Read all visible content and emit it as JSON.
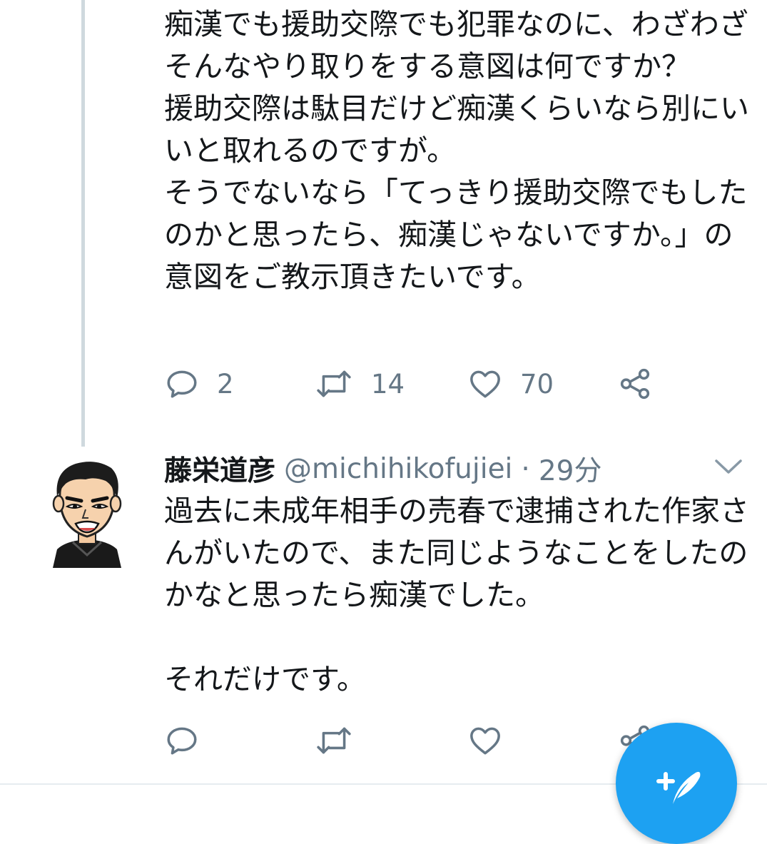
{
  "tweet1": {
    "text": "痴漢でも援助交際でも犯罪なのに、わざわざそんなやり取りをする意図は何ですか？\n援助交際は駄目だけど痴漢くらいなら別にいいと取れるのですが。\nそうでないなら「てっきり援助交際でもしたのかと思ったら、痴漢じゃないですか。」の意図をご教示頂きたいです。",
    "reply_count": "2",
    "retweet_count": "14",
    "like_count": "70"
  },
  "tweet2": {
    "display_name": "藤栄道彦",
    "handle": "@michihikofujiei",
    "separator": "·",
    "time": "29分",
    "text": "過去に未成年相手の売春で逮捕された作家さんがいたので、また同じようなことをしたのかなと思ったら痴漢でした。\n\nそれだけです。"
  },
  "icons": {
    "reply": "reply-icon",
    "retweet": "retweet-icon",
    "like": "heart-icon",
    "share": "share-icon",
    "more": "chevron-down-icon",
    "compose": "compose-tweet-icon"
  },
  "colors": {
    "accent": "#1da1f2",
    "secondary_text": "#657786",
    "thread_line": "#cfd9de",
    "primary_text": "#14171a"
  }
}
